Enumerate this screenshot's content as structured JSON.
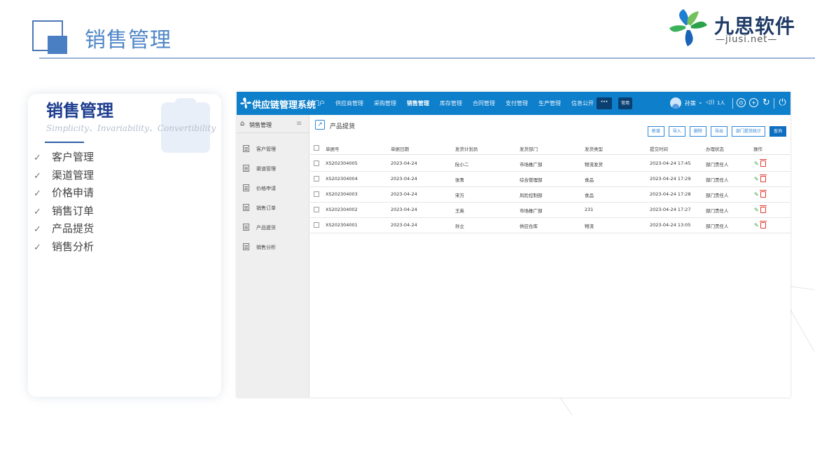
{
  "slide": {
    "title": "销售管理",
    "logo": {
      "name": "九思软件",
      "url": "—jiusi.net—"
    }
  },
  "card": {
    "title": "销售管理",
    "subtitle": "Simplicity、Invariability、Convertibility",
    "check_icon": "check-icon",
    "items": [
      "客户管理",
      "渠道管理",
      "价格申请",
      "销售订单",
      "产品提货",
      "销售分析"
    ]
  },
  "app": {
    "system_name": "供应链管理系统",
    "nav": [
      "门户",
      "供应商管理",
      "采购管理",
      "销售管理",
      "库存管理",
      "合同管理",
      "支付管理",
      "生产管理",
      "信息公开"
    ],
    "active_nav": "销售管理",
    "more": "···",
    "common": "常用",
    "user": "孙策",
    "volume": "◁))",
    "online_count": "1人",
    "colors": {
      "topbar": "#0e7fca",
      "accent": "#2f86d6",
      "delete": "#e03a2f",
      "edit": "#3aa43a"
    },
    "sidebar": {
      "home_icon": "home-icon",
      "title": "销售管理",
      "menu_icon": "hamburger-icon",
      "items": [
        "客户管理",
        "渠道管理",
        "价格申请",
        "销售订单",
        "产品提货",
        "销售分析"
      ]
    },
    "page": {
      "title": "产品提货",
      "buttons": [
        "新增",
        "导入",
        "删除",
        "导出",
        "部门提货统计",
        "查询"
      ]
    },
    "table": {
      "columns": [
        "单据号",
        "单据日期",
        "发货计划员",
        "发货部门",
        "发货类型",
        "提交时间",
        "办理状态",
        "操作"
      ],
      "rows": [
        [
          "XS202304005",
          "2023-04-24",
          "阮小二",
          "市场推广部",
          "物流发货",
          "2023-04-24 17:45",
          "部门责任人"
        ],
        [
          "XS202304004",
          "2023-04-24",
          "张青",
          "综合管理部",
          "食品",
          "2023-04-24 17:29",
          "部门责任人"
        ],
        [
          "XS202304003",
          "2023-04-24",
          "宋万",
          "风险控制部",
          "食品",
          "2023-04-24 17:28",
          "部门责任人"
        ],
        [
          "XS202304002",
          "2023-04-24",
          "王英",
          "市场推广部",
          "231",
          "2023-04-24 17:27",
          "部门责任人"
        ],
        [
          "XS202304001",
          "2023-04-24",
          "孙立",
          "供应仓库",
          "物流",
          "2023-04-24 13:05",
          "部门责任人"
        ]
      ]
    }
  }
}
